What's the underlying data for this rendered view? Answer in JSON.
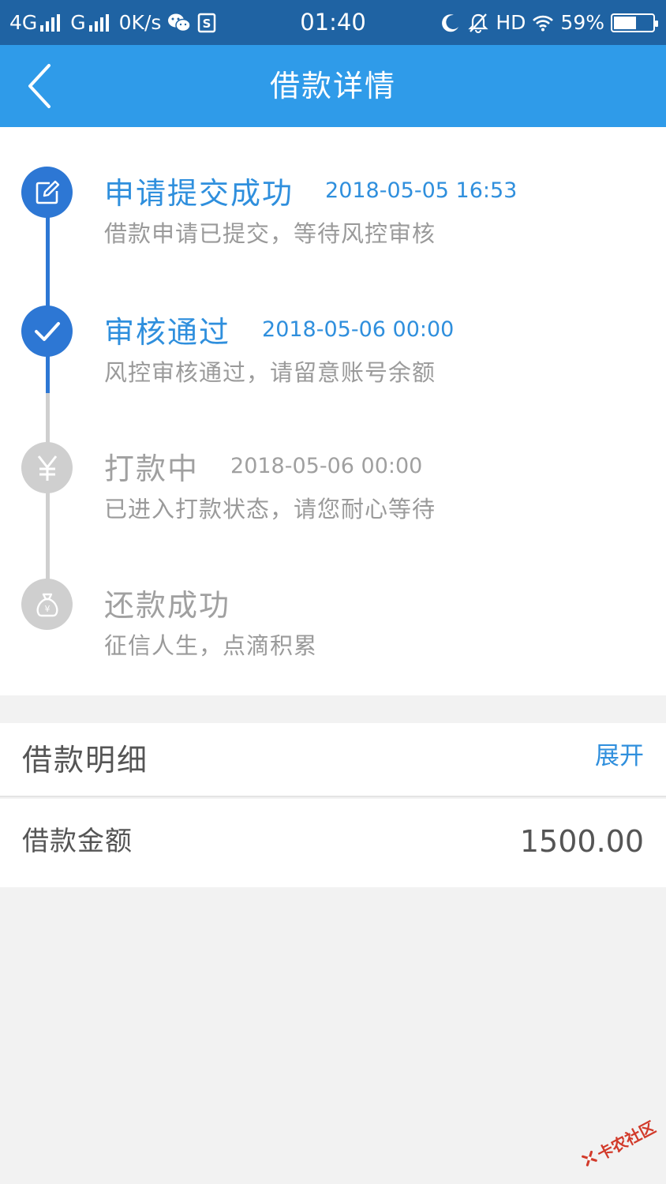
{
  "status_bar": {
    "network_1": "4G",
    "network_2": "G",
    "speed": "0K/s",
    "time": "01:40",
    "hd": "HD",
    "battery": "59%",
    "battery_level": 0.59
  },
  "header": {
    "title": "借款详情",
    "color": "#2f9be9"
  },
  "timeline": {
    "active_color": "#2d77d4",
    "inactive_color": "#cfcfcf",
    "steps": [
      {
        "title": "申请提交成功",
        "time": "2018-05-05 16:53",
        "desc": "借款申请已提交，等待风控审核",
        "icon": "edit-icon"
      },
      {
        "title": "审核通过",
        "time": "2018-05-06 00:00",
        "desc": "风控审核通过，请留意账号余额",
        "icon": "check-icon"
      },
      {
        "title": "打款中",
        "time": "2018-05-06 00:00",
        "desc": "已进入打款状态，请您耐心等待",
        "icon": "yuan-icon"
      },
      {
        "title": "还款成功",
        "time": "",
        "desc": "征信人生，点滴积累",
        "icon": "money-bag-icon"
      }
    ]
  },
  "details": {
    "section_title": "借款明细",
    "toggle_label": "展开",
    "amount_label": "借款金额",
    "amount_value": "1500.00"
  },
  "watermark": {
    "text": "卡农社区"
  }
}
